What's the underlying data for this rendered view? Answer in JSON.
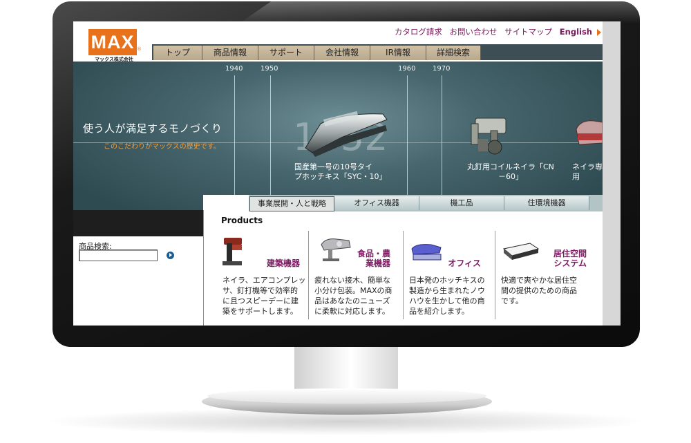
{
  "brand": {
    "logo": "MAX",
    "registered": "®",
    "company": "マックス株式会社",
    "accent": "#e8711c"
  },
  "top_links": [
    "カタログ請求",
    "お問い合わせ",
    "サイトマップ",
    "English"
  ],
  "nav_tabs": [
    "トップ",
    "商品情報",
    "サポート",
    "会社情報",
    "IR情報",
    "詳細検索"
  ],
  "hero": {
    "title": "使う人が満足するモノづくり",
    "subtitle": "このこだわりがマックスの歴史です。",
    "years": [
      "1940",
      "1950",
      "1960",
      "1970"
    ],
    "big_year": "1952",
    "captions": [
      {
        "line1": "国産第一号の10号タイ",
        "line2": "プホッチキス「SYC・10」"
      },
      {
        "line1": "丸釘用コイルネイラ「CN",
        "line2": "－60」"
      },
      {
        "line1": "ネイラ専用",
        "line2": ""
      }
    ]
  },
  "sub_tabs": [
    "事業展開・人と戦略",
    "オフィス機器",
    "機工品",
    "住環境機器"
  ],
  "search": {
    "label": "商品検索:",
    "value": ""
  },
  "products": {
    "heading": "Products",
    "items": [
      {
        "name": "建築機器",
        "desc": [
          "ネイラ、エアコンプレッ",
          "サ、釘打機等で効率的",
          "に且つスピーデーに建",
          "築をサポートします。"
        ]
      },
      {
        "name_lines": [
          "食品・農",
          "業機器"
        ],
        "desc": [
          "疲れない接木、簡単な",
          "小分け包装。MAXの商",
          "品はあなたのニューズ",
          "に柔軟に対応します。"
        ]
      },
      {
        "name": "オフィス",
        "desc": [
          "日本発のホッチキスの",
          "製造から生まれたノウ",
          "ハウを生かして他の商",
          "品を紹介します。"
        ]
      },
      {
        "name_lines": [
          "居住空間",
          "システム"
        ],
        "desc": [
          "快適で爽やかな居住空",
          "間の提供のための商品",
          "です。"
        ]
      }
    ]
  }
}
